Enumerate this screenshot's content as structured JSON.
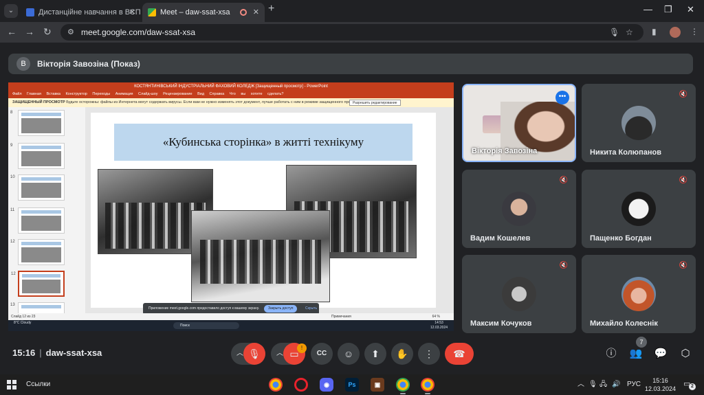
{
  "browser": {
    "tabs": [
      {
        "label": "Дистанційне навчання в ВСП",
        "active": false
      },
      {
        "label": "Meet – daw-ssat-xsa",
        "active": true
      }
    ],
    "url": "meet.google.com/daw-ssat-xsa"
  },
  "meet": {
    "presenter_initial": "В",
    "presenter_label": "Вікторія Завозіна (Показ)",
    "time": "15:16",
    "meeting_code": "daw-ssat-xsa",
    "participant_count": "7",
    "camera_badge": "!",
    "participants": [
      {
        "name": "Вікторія Завозіна",
        "speaking": true
      },
      {
        "name": "Никита Колюпанов"
      },
      {
        "name": "Вадим Кошелев"
      },
      {
        "name": "Пащенко Богдан"
      },
      {
        "name": "Максим Кочуков"
      },
      {
        "name": "Михайло Колеснік"
      }
    ]
  },
  "shared_screen": {
    "window_title": "КОСТЯНТИНІВСЬКИЙ ІНДУСТРІАЛЬНИЙ ФАХОВИЙ КОЛЕДЖ [Защищенный просмотр] - PowerPoint",
    "ribbon": "Файл Главная Вставка Конструктор Переходы Анимация Слайд-шоу Рецензирование Вид Справка Что вы хотите сделать?",
    "warning_title": "ЗАЩИЩЕННЫЙ ПРОСМОТР",
    "warning_text": "Будьте осторожны: файлы из Интернета могут содержать вирусы. Если вам не нужно изменять этот документ, лучше работать с ним в режиме защищенного просмотра.",
    "enable_editing": "Разрешить редактирование",
    "slide_numbers": [
      "8",
      "9",
      "10",
      "11",
      "12",
      "13"
    ],
    "selected_slide": "12",
    "slide_title": "«Кубинська сторінка» в житті технікуму",
    "status_left": "Слайд 12 из 23",
    "status_notes": "Примечания",
    "zoom": "64 %",
    "share_notice": "Приложение meet.google.com предоставило доступ к вашему экрану.",
    "stop_sharing": "Закрыть доступ",
    "hide": "Скрыть",
    "weather": "8°C Cloudy",
    "search": "Поиск",
    "clock": "14:53",
    "date": "12.03.2024"
  },
  "taskbar": {
    "links_label": "Ссылки",
    "lang": "РУС",
    "time": "15:16",
    "date": "12.03.2024",
    "notifications": "2"
  }
}
